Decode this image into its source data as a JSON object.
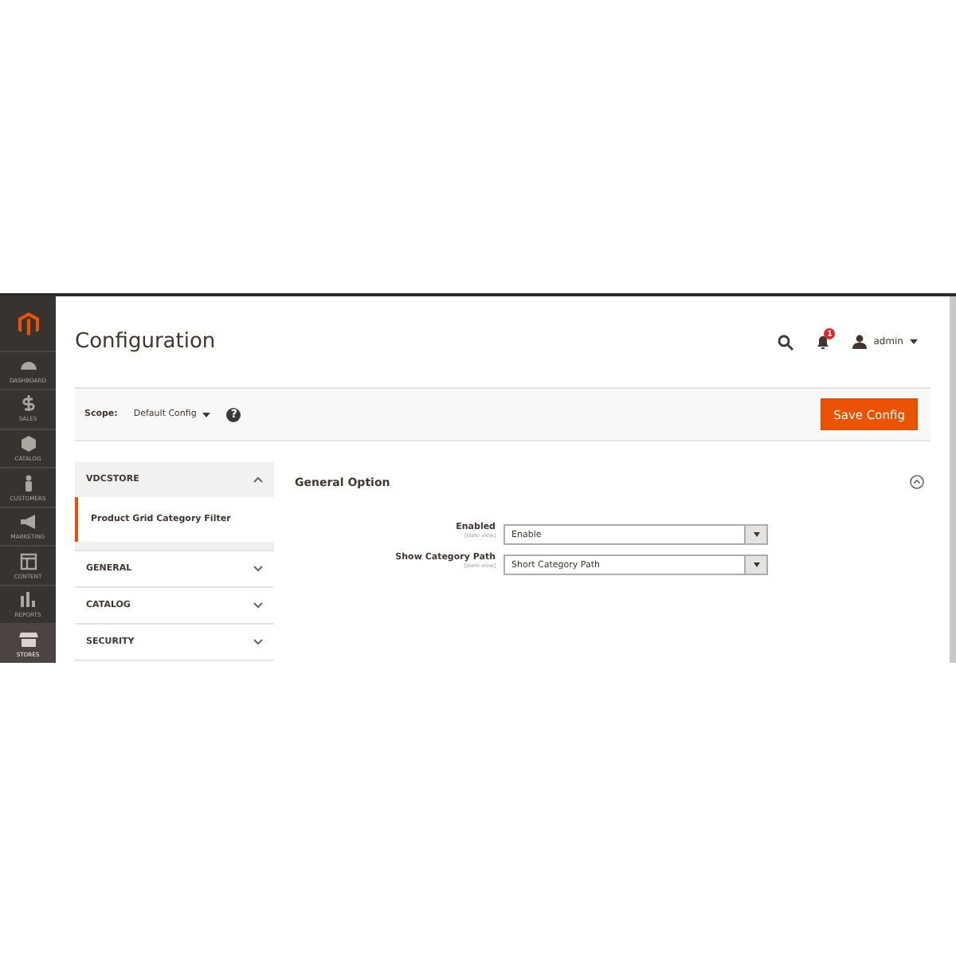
{
  "menu": [
    {
      "label": "DASHBOARD",
      "selected": false
    },
    {
      "label": "SALES",
      "selected": false
    },
    {
      "label": "CATALOG",
      "selected": false
    },
    {
      "label": "CUSTOMERS",
      "selected": false
    },
    {
      "label": "MARKETING",
      "selected": false
    },
    {
      "label": "CONTENT",
      "selected": false
    },
    {
      "label": "REPORTS",
      "selected": false
    },
    {
      "label": "STORES",
      "selected": true
    }
  ],
  "page_title": "Configuration",
  "header": {
    "notifications": "1",
    "user": "admin"
  },
  "scope": {
    "label": "Scope:",
    "value": "Default Config",
    "help": "?"
  },
  "save_button": "Save Config",
  "nav": [
    {
      "title": "VDCSTORE",
      "expanded": true,
      "children": [
        {
          "label": "Product Grid Category Filter",
          "selected": true
        }
      ]
    },
    {
      "title": "GENERAL",
      "expanded": false
    },
    {
      "title": "CATALOG",
      "expanded": false
    },
    {
      "title": "SECURITY",
      "expanded": false
    }
  ],
  "section": {
    "title": "General Option",
    "expanded": true,
    "fields": [
      {
        "label": "Enabled",
        "note": "[store view]",
        "value": "Enable"
      },
      {
        "label": "Show Category Path",
        "note": "[store view]",
        "value": "Short Category Path"
      }
    ]
  }
}
